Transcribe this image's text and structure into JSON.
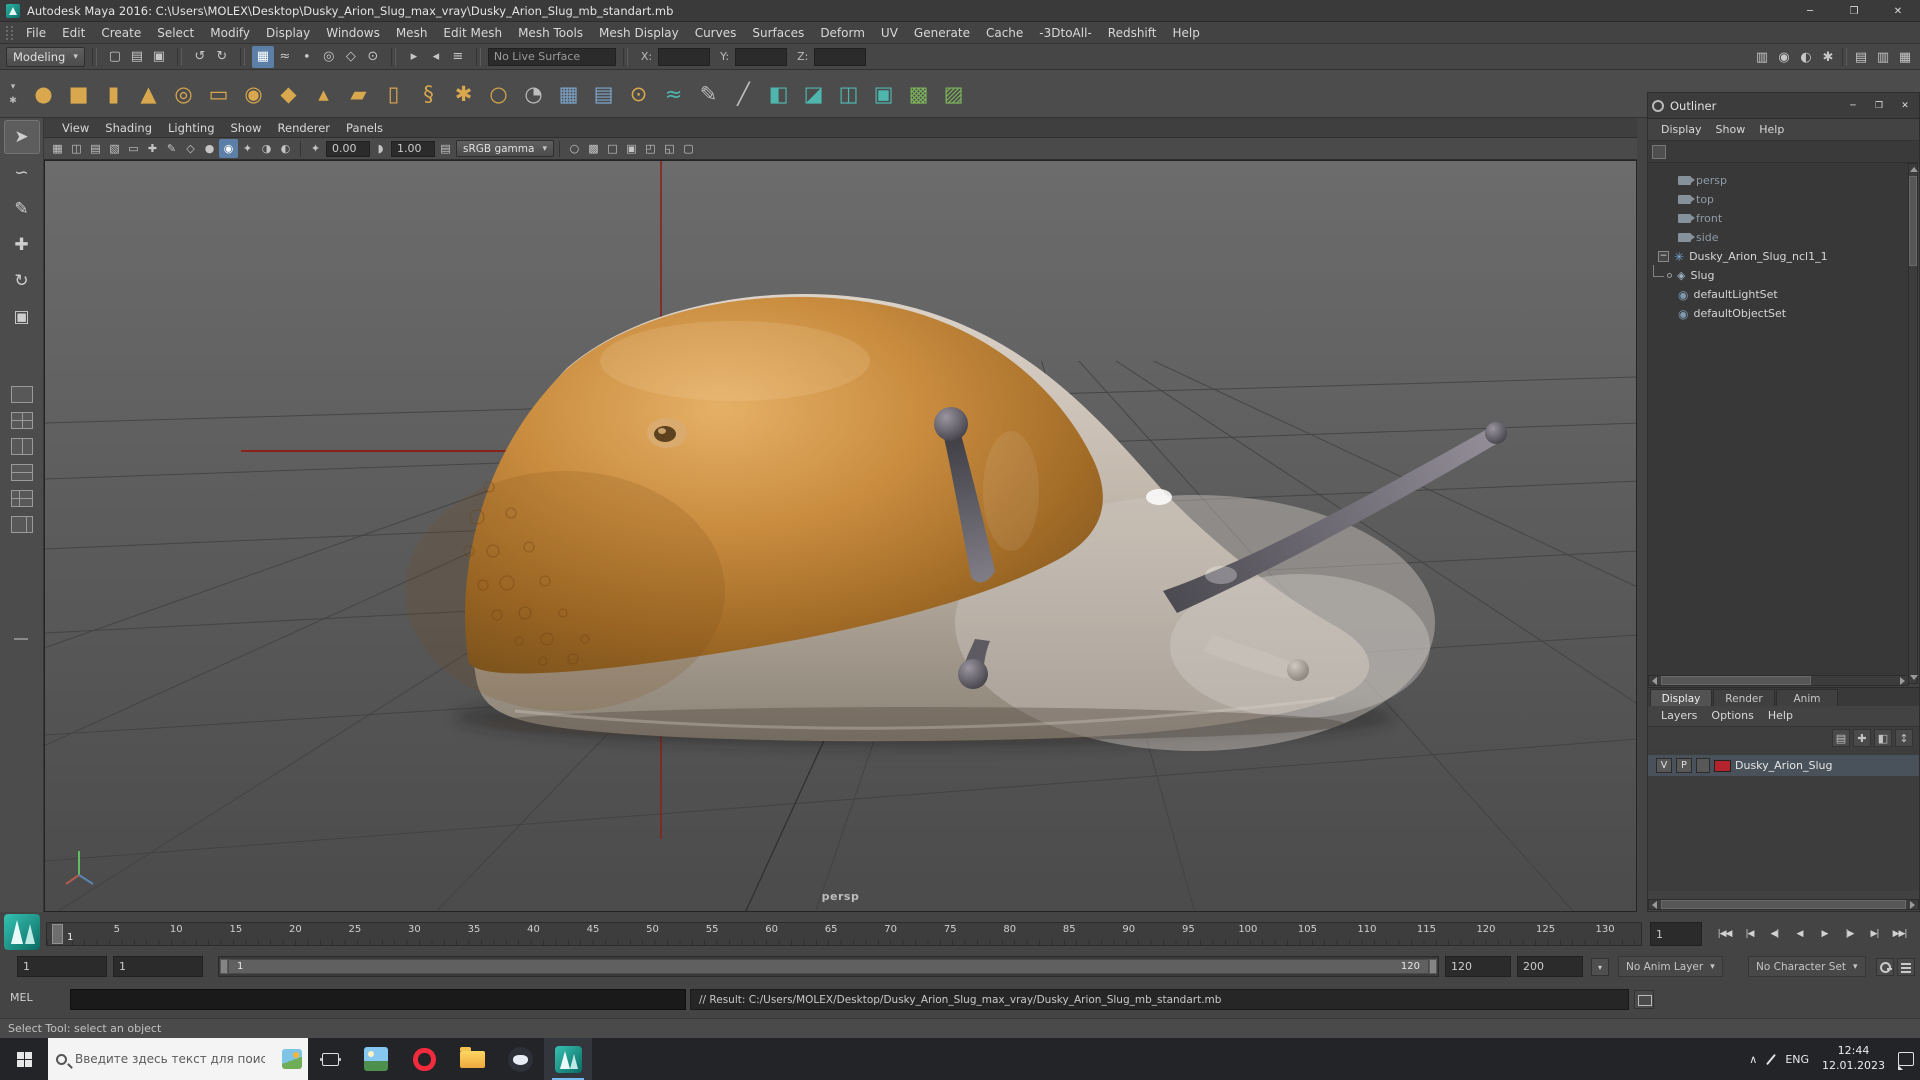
{
  "colors": {
    "accent_blue": "#5b7fa6",
    "layer_swatch_red": "#b5242c",
    "maya_teal": "#18a398",
    "axis_red": "#88231a"
  },
  "titlebar": {
    "title": "Autodesk Maya 2016: C:\\Users\\MOLEX\\Desktop\\Dusky_Arion_Slug_max_vray\\Dusky_Arion_Slug_mb_standart.mb",
    "minimize": "─",
    "maximize": "❐",
    "close": "✕"
  },
  "menubar": {
    "items": [
      "File",
      "Edit",
      "Create",
      "Select",
      "Modify",
      "Display",
      "Windows",
      "Mesh",
      "Edit Mesh",
      "Mesh Tools",
      "Mesh Display",
      "Curves",
      "Surfaces",
      "Deform",
      "UV",
      "Generate",
      "Cache",
      "-3DtoAll-",
      "Redshift",
      "Help"
    ]
  },
  "statusline": {
    "mode": "Modeling",
    "caret": "▾",
    "live_surface": "No Live Surface",
    "x_label": "X:",
    "y_label": "Y:",
    "z_label": "Z:",
    "file_icons": [
      {
        "n": "new-scene-icon",
        "g": "▢"
      },
      {
        "n": "open-scene-icon",
        "g": "▤"
      },
      {
        "n": "save-scene-icon",
        "g": "▣"
      }
    ],
    "history_icons": [
      {
        "n": "undo-icon",
        "g": "↺"
      },
      {
        "n": "redo-icon",
        "g": "↻"
      }
    ],
    "snap_icons": [
      {
        "n": "snap-to-grids-icon",
        "g": "▦",
        "hl": "on"
      },
      {
        "n": "snap-to-curves-icon",
        "g": "≈"
      },
      {
        "n": "snap-to-points-icon",
        "g": "∙"
      },
      {
        "n": "snap-to-projected-center-icon",
        "g": "◎"
      },
      {
        "n": "snap-to-view-planes-icon",
        "g": "◇"
      },
      {
        "n": "make-live-icon",
        "g": "⊙"
      }
    ],
    "ops_icons": [
      {
        "n": "input-connections-icon",
        "g": "▸"
      },
      {
        "n": "output-connections-icon",
        "g": "◂"
      },
      {
        "n": "construction-history-icon",
        "g": "≡"
      }
    ],
    "render_icons": [
      {
        "n": "open-render-view-icon",
        "g": "▥"
      },
      {
        "n": "render-current-frame-icon",
        "g": "◉"
      },
      {
        "n": "ipr-render-icon",
        "g": "◐"
      },
      {
        "n": "render-settings-icon",
        "g": "✱"
      }
    ],
    "sidebar_icons": [
      {
        "n": "attribute-editor-toggle-icon",
        "g": "▤"
      },
      {
        "n": "tool-settings-toggle-icon",
        "g": "▥"
      },
      {
        "n": "channel-box-toggle-icon",
        "g": "▦"
      }
    ]
  },
  "shelf": {
    "icons": [
      {
        "n": "poly-sphere-icon",
        "g": "●",
        "c": "gold"
      },
      {
        "n": "poly-cube-icon",
        "g": "■",
        "c": "gold"
      },
      {
        "n": "poly-cylinder-icon",
        "g": "▮",
        "c": "gold"
      },
      {
        "n": "poly-cone-icon",
        "g": "▲",
        "c": "gold"
      },
      {
        "n": "poly-torus-icon",
        "g": "◎",
        "c": "gold"
      },
      {
        "n": "poly-plane-icon",
        "g": "▭",
        "c": "gold"
      },
      {
        "n": "poly-disc-icon",
        "g": "◉",
        "c": "gold"
      },
      {
        "n": "poly-platonic-icon",
        "g": "◆",
        "c": "gold"
      },
      {
        "n": "poly-pyramid-icon",
        "g": "▴",
        "c": "gold"
      },
      {
        "n": "poly-prism-icon",
        "g": "▰",
        "c": "gold"
      },
      {
        "n": "poly-pipe-icon",
        "g": "▯",
        "c": "gold"
      },
      {
        "n": "poly-helix-icon",
        "g": "§",
        "c": "gold"
      },
      {
        "n": "poly-gear-icon",
        "g": "✱",
        "c": "gold"
      },
      {
        "n": "poly-soccer-ball-icon",
        "g": "○",
        "c": "gold"
      },
      {
        "n": "sculpt-tool-icon",
        "g": "◔",
        "c": "gray"
      },
      {
        "n": "uv-grid-icon",
        "g": "▦",
        "c": "blue"
      },
      {
        "n": "mesh-grid-icon",
        "g": "▤",
        "c": "blue"
      },
      {
        "n": "nurbs-sphere-icon",
        "g": "⊙",
        "c": "gold"
      },
      {
        "n": "curve-tool-icon",
        "g": "≈",
        "c": "teal"
      },
      {
        "n": "pencil-curve-icon",
        "g": "✎",
        "c": "gray"
      },
      {
        "n": "knife-tool-icon",
        "g": "╱",
        "c": "gray"
      },
      {
        "n": "mirror-icon",
        "g": "◧",
        "c": "teal"
      },
      {
        "n": "bevel-icon",
        "g": "◪",
        "c": "teal"
      },
      {
        "n": "bridge-icon",
        "g": "◫",
        "c": "teal"
      },
      {
        "n": "extrude-icon",
        "g": "▣",
        "c": "teal"
      },
      {
        "n": "checker-a-icon",
        "g": "▩",
        "c": "green"
      },
      {
        "n": "checker-b-icon",
        "g": "▨",
        "c": "green"
      }
    ],
    "switch_caret": "▾",
    "switch_gear": "✱"
  },
  "toolbox": {
    "tools": [
      {
        "n": "select-tool-icon",
        "g": "➤",
        "hl": "sel"
      },
      {
        "n": "lasso-tool-icon",
        "g": "∽"
      },
      {
        "n": "paint-select-tool-icon",
        "g": "✎"
      },
      {
        "n": "move-tool-icon",
        "g": "✚"
      },
      {
        "n": "rotate-tool-icon",
        "g": "↻"
      },
      {
        "n": "scale-tool-icon",
        "g": "▣"
      }
    ]
  },
  "panel": {
    "menus": [
      "View",
      "Shading",
      "Lighting",
      "Show",
      "Renderer",
      "Panels"
    ],
    "toolbar_icons_a": [
      {
        "n": "select-camera-icon",
        "g": "▦"
      },
      {
        "n": "lock-camera-icon",
        "g": "◫"
      },
      {
        "n": "camera-attributes-icon",
        "g": "▤"
      },
      {
        "n": "bookmarks-icon",
        "g": "▧"
      },
      {
        "n": "image-plane-icon",
        "g": "▭"
      },
      {
        "n": "2d-pan-zoom-icon",
        "g": "✚"
      },
      {
        "n": "grease-pencil-icon",
        "g": "✎"
      },
      {
        "n": "wireframe-icon",
        "g": "◇"
      },
      {
        "n": "shaded-icon",
        "g": "●"
      },
      {
        "n": "textured-icon",
        "g": "◉",
        "hl": "on"
      },
      {
        "n": "use-all-lights-icon",
        "g": "✦"
      },
      {
        "n": "shadows-icon",
        "g": "◑"
      },
      {
        "n": "screen-space-ao-icon",
        "g": "◐"
      }
    ],
    "exposure_icon": "✦",
    "exposure": "0.00",
    "gamma_icon": "◗",
    "gamma": "1.00",
    "colorspace_icon": "▤",
    "colorspace": "sRGB gamma",
    "caret": "▾",
    "toolbar_icons_b": [
      {
        "n": "isolate-select-icon",
        "g": "○"
      },
      {
        "n": "field-chart-icon",
        "g": "▩"
      },
      {
        "n": "resolution-gate-icon",
        "g": "□"
      },
      {
        "n": "gate-mask-icon",
        "g": "▣"
      },
      {
        "n": "safe-action-icon",
        "g": "◰"
      },
      {
        "n": "safe-title-icon",
        "g": "◱"
      },
      {
        "n": "xray-icon",
        "g": "▢"
      }
    ],
    "camera_label": "persp"
  },
  "outliner": {
    "title": "Outliner",
    "window_buttons": {
      "minimize": "─",
      "maximize": "❐",
      "close": "✕"
    },
    "menus": [
      "Display",
      "Show",
      "Help"
    ],
    "rows": {
      "cameras": [
        "persp",
        "top",
        "front",
        "side"
      ],
      "group_label": "Dusky_Arion_Slug_ncl1_1",
      "child_label": "Slug",
      "sets": [
        "defaultLightSet",
        "defaultObjectSet"
      ]
    },
    "icons": {
      "expander": "−",
      "group_star": "✳",
      "mesh": "◈",
      "set": "◉"
    }
  },
  "layer_editor": {
    "tabs": [
      "Display",
      "Render",
      "Anim"
    ],
    "menus": [
      "Layers",
      "Options",
      "Help"
    ],
    "toolbar_icons": [
      {
        "n": "layer-options-icon",
        "g": "▤"
      },
      {
        "n": "new-empty-layer-icon",
        "g": "✚"
      },
      {
        "n": "new-layer-from-selected-icon",
        "g": "◧"
      },
      {
        "n": "move-layer-icon",
        "g": "↕"
      }
    ],
    "layer": {
      "visibility": "V",
      "playback": "P",
      "name": "Dusky_Arion_Slug",
      "swatch_color": "#b5242c"
    }
  },
  "timeline": {
    "ticks": [
      "5",
      "10",
      "15",
      "20",
      "25",
      "30",
      "35",
      "40",
      "45",
      "50",
      "55",
      "60",
      "65",
      "70",
      "75",
      "80",
      "85",
      "90",
      "95",
      "100",
      "105",
      "110",
      "115",
      "120",
      "125",
      "130"
    ],
    "current_frame": "1",
    "current_frame_field": "1",
    "playback": [
      {
        "n": "go-to-start-button",
        "g": "|◀◀"
      },
      {
        "n": "step-back-key-button",
        "g": "|◀"
      },
      {
        "n": "step-back-frame-button",
        "g": "◀|"
      },
      {
        "n": "play-backwards-button",
        "g": "◀"
      },
      {
        "n": "play-forwards-button",
        "g": "▶"
      },
      {
        "n": "step-forward-frame-button",
        "g": "|▶"
      },
      {
        "n": "step-forward-key-button",
        "g": "▶|"
      },
      {
        "n": "go-to-end-button",
        "g": "▶▶|"
      }
    ]
  },
  "range": {
    "animation_start": "1",
    "playback_start": "1",
    "range_label_start": "1",
    "range_label_end": "120",
    "playback_end": "120",
    "animation_end": "200",
    "caret": "▾",
    "anim_layer": "No Anim Layer",
    "character_set": "No Character Set"
  },
  "command_line": {
    "label": "MEL",
    "input_value": "",
    "result": "// Result: C:/Users/MOLEX/Desktop/Dusky_Arion_Slug_max_vray/Dusky_Arion_Slug_mb_standart.mb"
  },
  "help_line": {
    "text": "Select Tool: select an object"
  },
  "taskbar": {
    "search_placeholder": "Введите здесь текст для поиска",
    "apps": [
      "photos",
      "opera",
      "file-explorer",
      "discord",
      "maya"
    ],
    "chevron": "∧",
    "language": "ENG",
    "time": "12:44",
    "date": "12.01.2023"
  }
}
